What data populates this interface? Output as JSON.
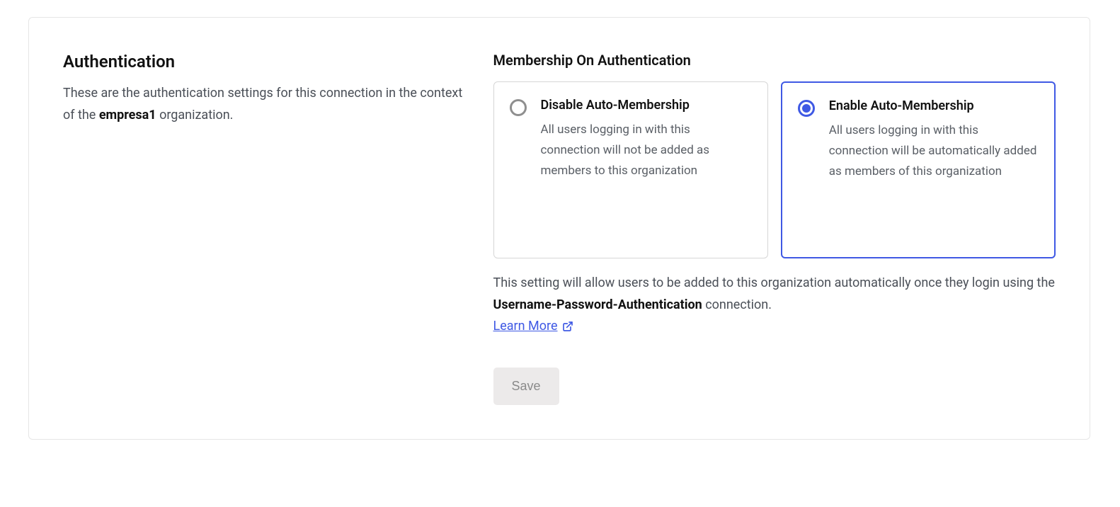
{
  "left": {
    "heading": "Authentication",
    "desc_pre": "These are the authentication settings for this connection in the context of the ",
    "org_name": "empresa1",
    "desc_post": " organization."
  },
  "right": {
    "section_title": "Membership On Authentication",
    "options": [
      {
        "title": "Disable Auto-Membership",
        "desc": "All users logging in with this connection will not be added as members to this organization",
        "selected": false
      },
      {
        "title": "Enable Auto-Membership",
        "desc": "All users logging in with this connection will be automatically added as members of this organization",
        "selected": true
      }
    ],
    "help_pre": "This setting will allow users to be added to this organization automatically once they login using the ",
    "connection_name": "Username-Password-Authentication",
    "help_post": " connection. ",
    "learn_more": "Learn More",
    "save_label": "Save"
  },
  "colors": {
    "accent": "#3f59e4"
  }
}
